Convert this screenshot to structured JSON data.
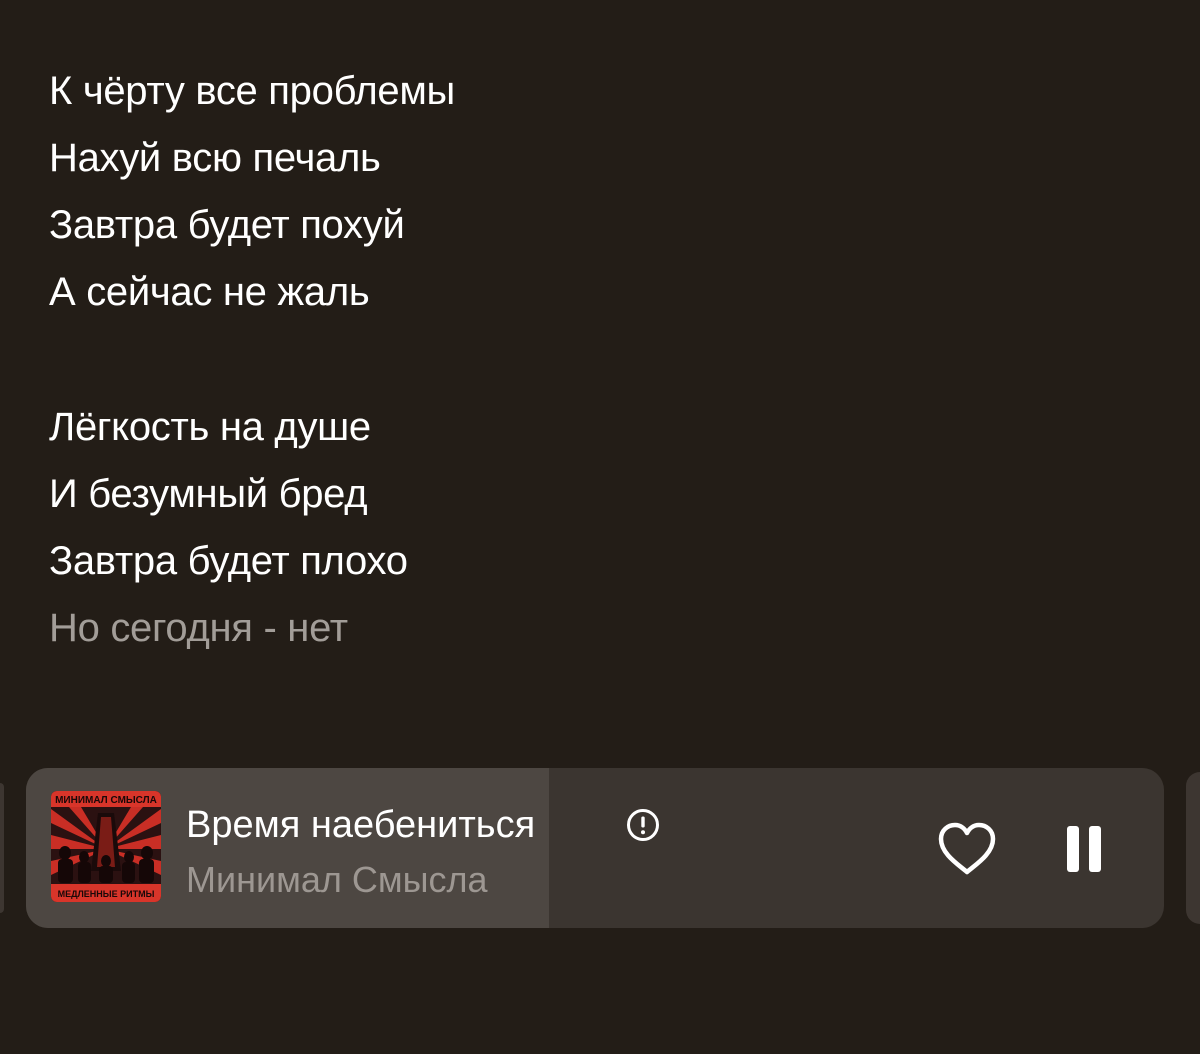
{
  "lyrics": {
    "stanzas": [
      {
        "lines": [
          "К чёрту все проблемы",
          "Нахуй всю печаль",
          "Завтра будет похуй",
          "А сейчас не жаль"
        ]
      },
      {
        "lines": [
          "Лёгкость на душе",
          "И безумный бред",
          "Завтра будет плохо",
          "Но сегодня - нет"
        ]
      }
    ],
    "current_stanza": 1,
    "dimmed_line_index": 3
  },
  "player": {
    "title": "Время наебениться",
    "artist": "Минимал Смысла",
    "explicit_icon": "explicit-icon",
    "cover_top_text": "МИНИМАЛ СМЫСЛА",
    "cover_bottom_text": "МЕДЛЕННЫЕ РИТМЫ",
    "progress": 0.46,
    "liked": false,
    "state": "playing",
    "like_icon": "heart-outline-icon",
    "pause_icon": "pause-icon"
  },
  "colors": {
    "background": "#231d17",
    "lyrics_text": "#ffffff",
    "lyrics_dim": "#a29d98",
    "player_bg": "#3b3530",
    "player_progress": "#4d4742",
    "artist_text": "#9d9792",
    "cover_red": "#d8352a"
  }
}
